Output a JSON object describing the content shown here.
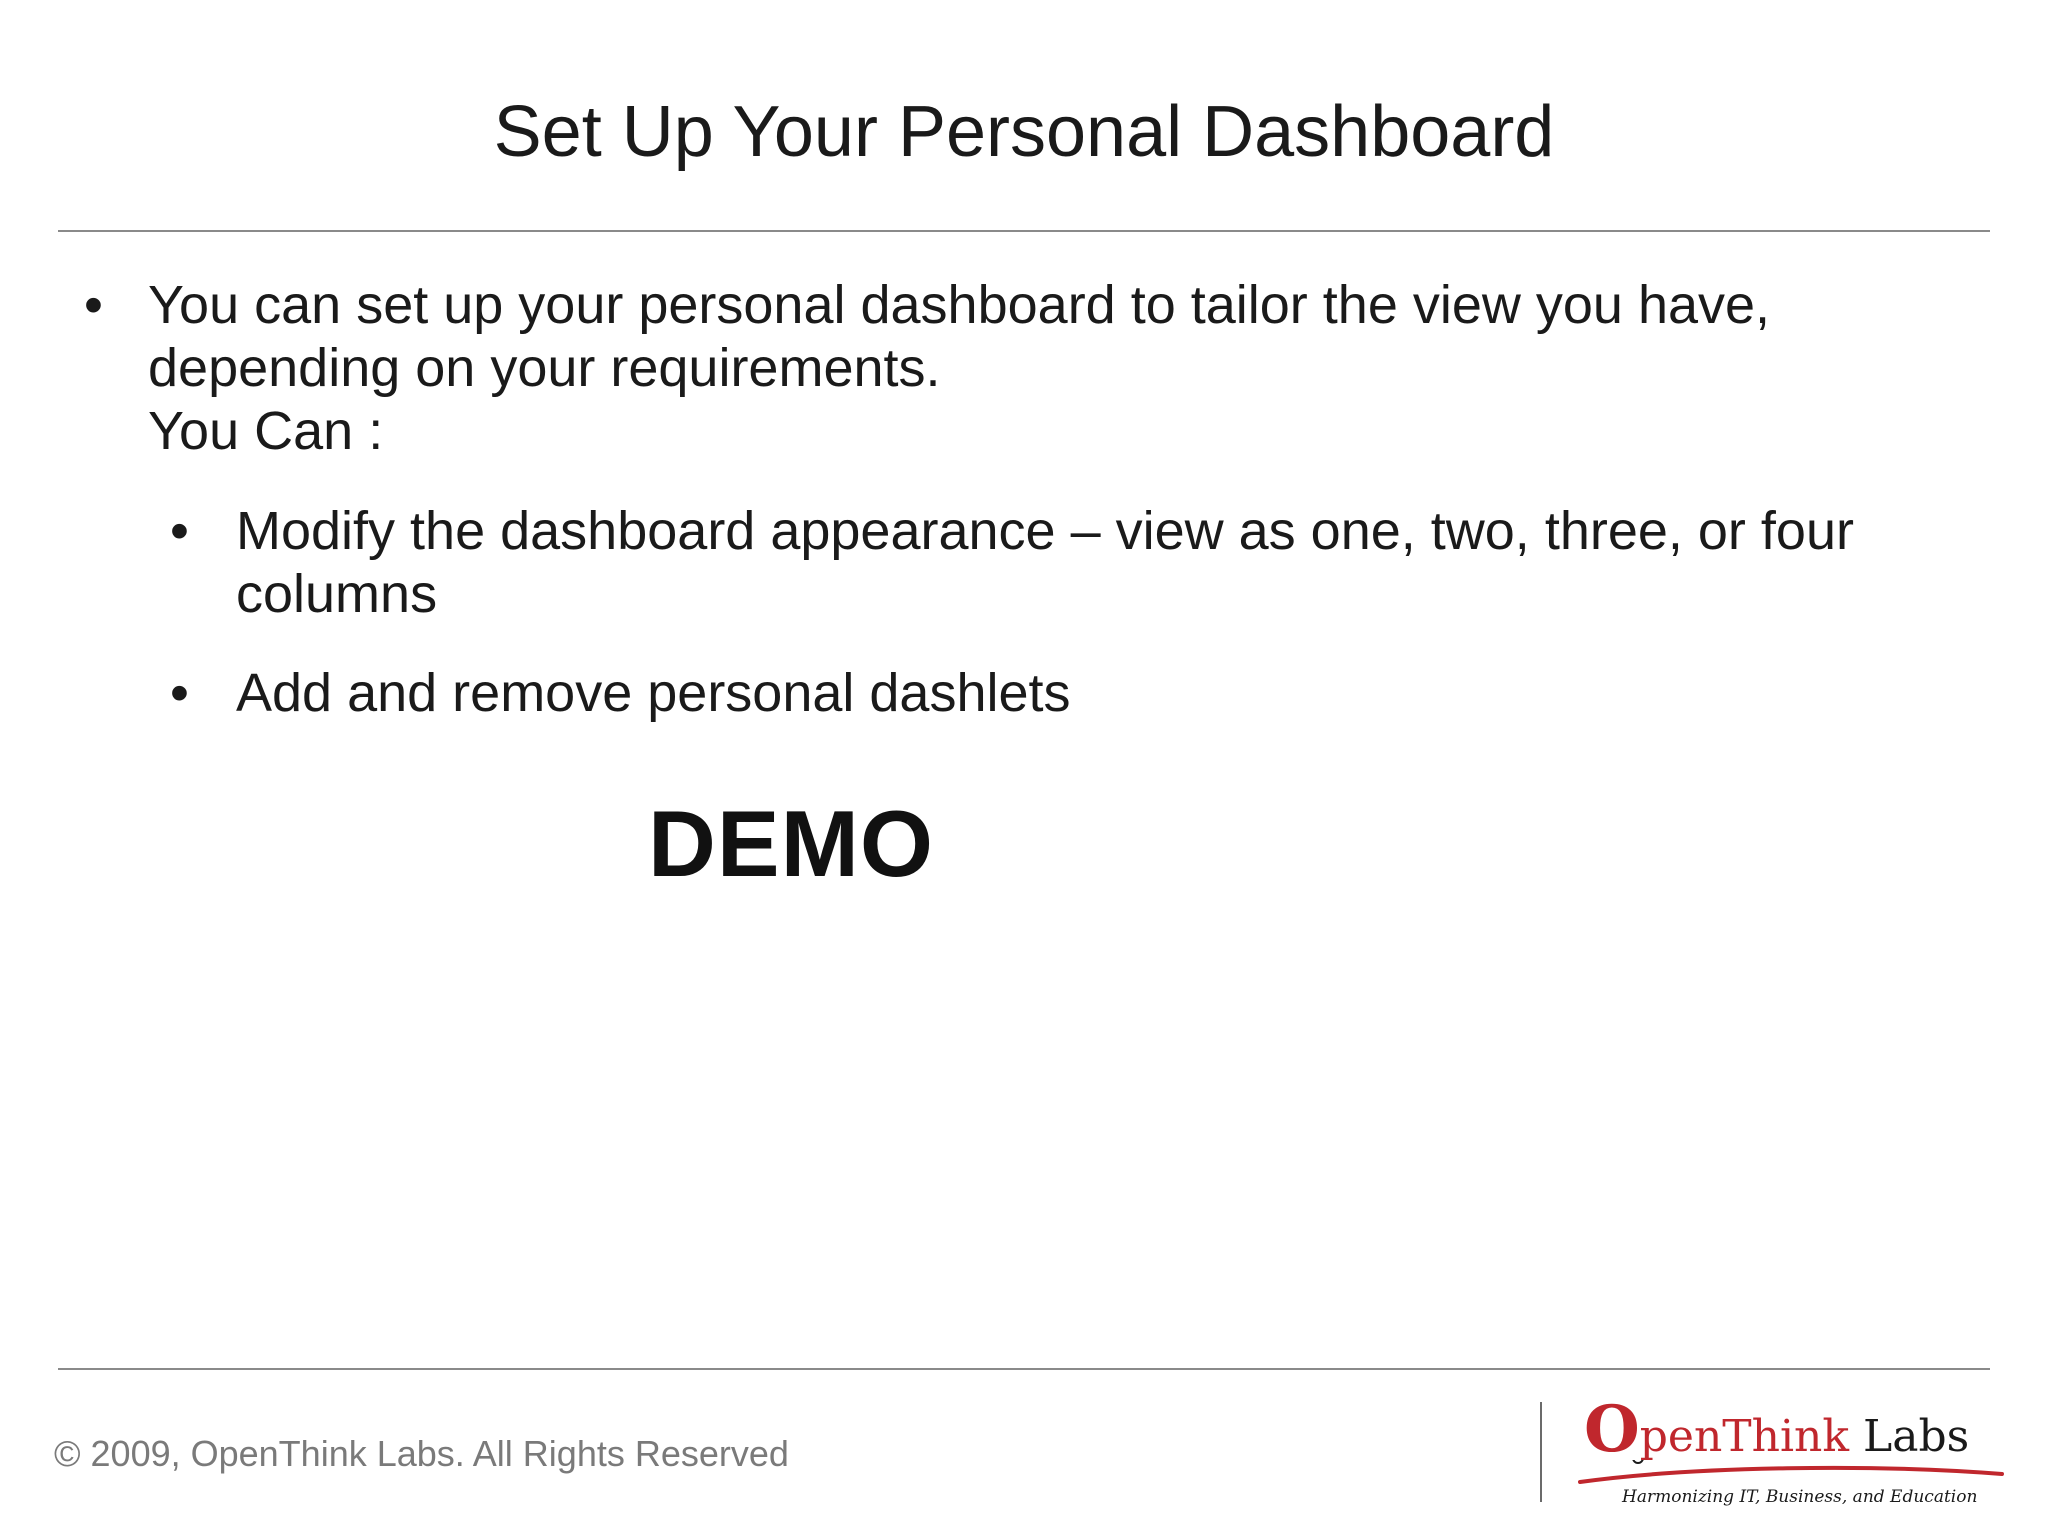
{
  "slide": {
    "title": "Set Up Your Personal Dashboard",
    "bullets": [
      {
        "marker": "•",
        "lines": [
          "You can set up your personal dashboard to tailor the view you have,",
          "depending on your requirements.",
          "You Can :"
        ],
        "sub_bullets": [
          {
            "marker": "•",
            "lines": [
              "Modify the dashboard appearance – view as one, two, three, or four",
              "columns"
            ]
          },
          {
            "marker": "•",
            "lines": [
              "Add and remove personal dashlets"
            ]
          }
        ]
      }
    ],
    "demo_label": "DEMO"
  },
  "footer": {
    "copyright": "© 2009, OpenThink Labs. All Rights Reserved",
    "logo": {
      "o_letter": "O",
      "name_red": "penThink",
      "name_dark": " Labs",
      "tagline": "Harmonizing IT, Business, and Education"
    }
  },
  "colors": {
    "brand_red": "#c0272d",
    "rule_gray": "#8a8a8a",
    "footer_text": "#7a7a7a"
  }
}
